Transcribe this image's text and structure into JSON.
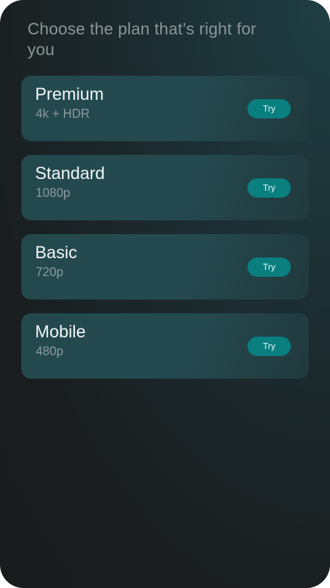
{
  "header": {
    "title": "Choose the plan that’s right for you"
  },
  "plans": [
    {
      "name": "Premium",
      "quality": "4k + HDR",
      "button_label": "Try"
    },
    {
      "name": "Standard",
      "quality": "1080p",
      "button_label": "Try"
    },
    {
      "name": "Basic",
      "quality": "720p",
      "button_label": "Try"
    },
    {
      "name": "Mobile",
      "quality": "480p",
      "button_label": "Try"
    }
  ],
  "colors": {
    "accent": "#0a7f80",
    "card": "#244a50",
    "background": "#1a1e1f",
    "heading_text": "#8b9697"
  }
}
